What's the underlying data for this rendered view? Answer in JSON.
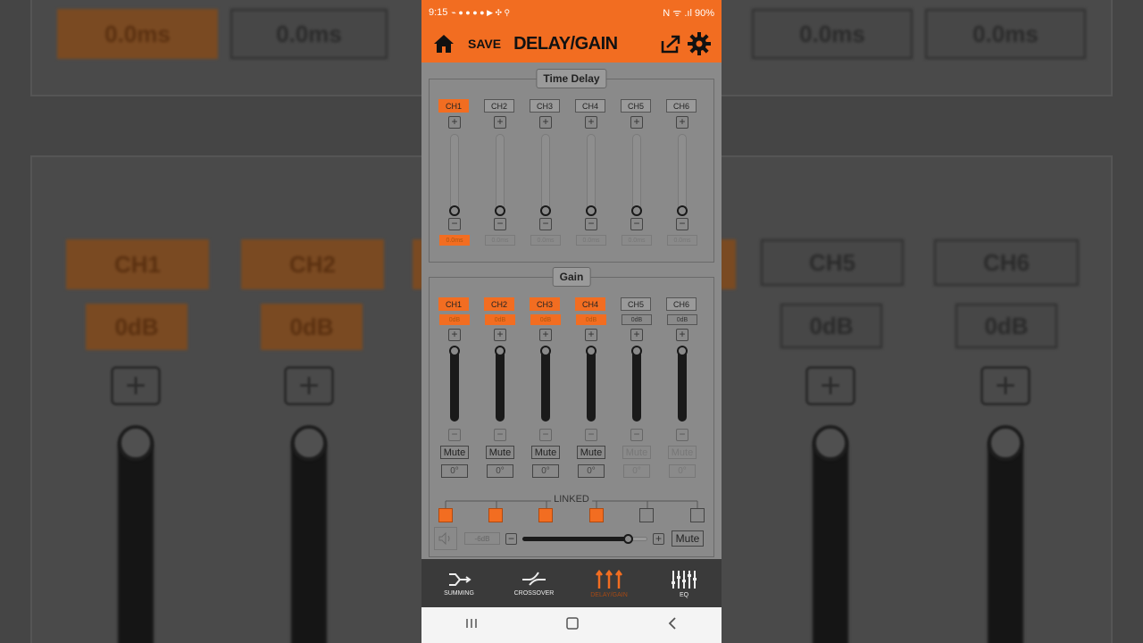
{
  "status": {
    "time": "9:15",
    "notif_icons": "⌁ ● ● ● ● ▶ ✣ ⚲",
    "right": "N ᯤ .ıl 90%"
  },
  "appbar": {
    "save_label": "SAVE",
    "title": "DELAY/GAIN"
  },
  "time_delay": {
    "title": "Time Delay",
    "channels": [
      {
        "label": "CH1",
        "selected": true,
        "value": "0.0ms"
      },
      {
        "label": "CH2",
        "selected": false,
        "value": "0.0ms"
      },
      {
        "label": "CH3",
        "selected": false,
        "value": "0.0ms"
      },
      {
        "label": "CH4",
        "selected": false,
        "value": "0.0ms"
      },
      {
        "label": "CH5",
        "selected": false,
        "value": "0.0ms"
      },
      {
        "label": "CH6",
        "selected": false,
        "value": "0.0ms"
      }
    ]
  },
  "gain": {
    "title": "Gain",
    "channels": [
      {
        "label": "CH1",
        "selected": true,
        "value": "0dB",
        "mute": "Mute",
        "phase": "0°",
        "linked": true
      },
      {
        "label": "CH2",
        "selected": true,
        "value": "0dB",
        "mute": "Mute",
        "phase": "0°",
        "linked": true
      },
      {
        "label": "CH3",
        "selected": true,
        "value": "0dB",
        "mute": "Mute",
        "phase": "0°",
        "linked": true
      },
      {
        "label": "CH4",
        "selected": true,
        "value": "0dB",
        "mute": "Mute",
        "phase": "0°",
        "linked": true
      },
      {
        "label": "CH5",
        "selected": false,
        "value": "0dB",
        "mute": "Mute",
        "phase": "0°",
        "linked": false
      },
      {
        "label": "CH6",
        "selected": false,
        "value": "0dB",
        "mute": "Mute",
        "phase": "0°",
        "linked": false
      }
    ],
    "linked_label": "LINKED"
  },
  "master": {
    "value": "-6dB",
    "mute_label": "Mute",
    "level": 0.85
  },
  "bottom_nav": [
    {
      "label": "SUMMING",
      "icon": "summing-icon",
      "active": false
    },
    {
      "label": "CROSSOVER",
      "icon": "crossover-icon",
      "active": false
    },
    {
      "label": "DELAY/GAIN",
      "icon": "delay-gain-icon",
      "active": true
    },
    {
      "label": "EQ",
      "icon": "eq-icon",
      "active": false
    }
  ],
  "background_mirror": {
    "value_a": "0.0ms",
    "value_b": "0.0ms",
    "ch1": "CH1",
    "ch2": "CH2",
    "ch5": "CH5",
    "ch6": "CH6",
    "db": "0dB"
  },
  "colors": {
    "accent": "#f26d21"
  }
}
